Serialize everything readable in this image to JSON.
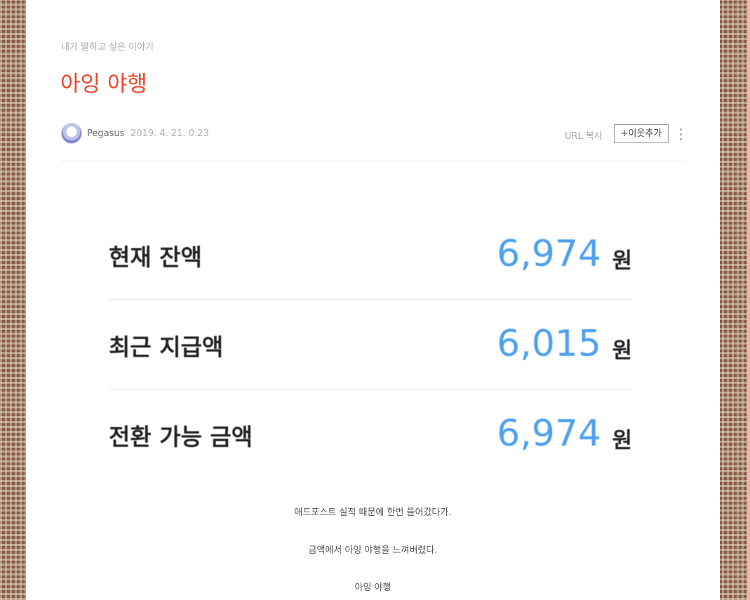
{
  "post": {
    "category": "내가 말하고 싶은 이야기",
    "title": "아잉 야행",
    "author": "Pegasus",
    "date": "2019. 4. 21. 0:23",
    "url_copy_label": "URL 복사",
    "add_neighbor_label": "+이웃추가"
  },
  "balance_image": {
    "rows": [
      {
        "label": "현재 잔액",
        "value": "6,974",
        "unit": "원"
      },
      {
        "label": "최근 지급액",
        "value": "6,015",
        "unit": "원"
      },
      {
        "label": "전환 가능 금액",
        "value": "6,974",
        "unit": "원"
      }
    ],
    "value_color": "#4da0ee"
  },
  "body": {
    "paragraphs": [
      "애드포스트 실적 때문에 한번 들어갔다가.",
      "금액에서 아잉 야행을 느껴버렸다.",
      "아잉 야행"
    ]
  },
  "colors": {
    "title": "#f0442b"
  },
  "icons": {
    "more": "more-vertical-icon",
    "avatar": "profile-avatar"
  }
}
